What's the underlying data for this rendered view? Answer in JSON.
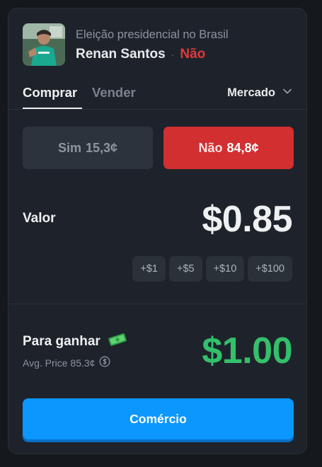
{
  "market": {
    "subtitle": "Eleição presidencial no Brasil",
    "candidate": "Renan Santos",
    "separator": "·",
    "outcome": "Não"
  },
  "tabs": {
    "buy": "Comprar",
    "sell": "Vender",
    "active": "buy"
  },
  "order_type": {
    "selected": "Mercado",
    "icon": "chevron-down-icon"
  },
  "outcome_buttons": {
    "yes": {
      "label": "Sim",
      "price": "15,3¢"
    },
    "no": {
      "label": "Não",
      "price": "84,8¢",
      "selected": true
    }
  },
  "amount": {
    "label": "Valor",
    "value": "$0.85"
  },
  "quick_add": [
    "+$1",
    "+$5",
    "+$10",
    "+$100"
  ],
  "to_win": {
    "label": "Para ganhar",
    "icon": "money-icon",
    "avg_price": "Avg. Price 85.3¢",
    "avg_icon": "dollar-circle-icon",
    "value": "$1.00"
  },
  "trade_button": {
    "label": "Comércio"
  },
  "colors": {
    "background": "#15191e",
    "card": "#1e232b",
    "no_red": "#d22f31",
    "win_green": "#34c06b",
    "trade_blue": "#0b97ff"
  }
}
